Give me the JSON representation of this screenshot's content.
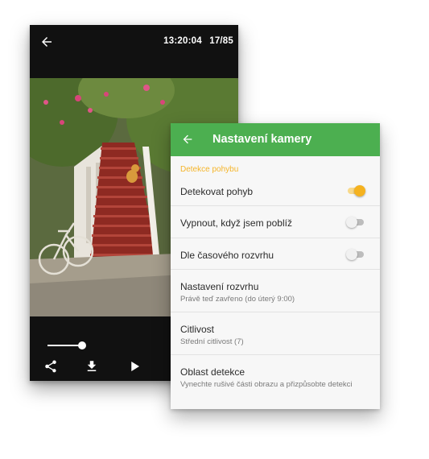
{
  "viewer": {
    "time": "13:20:04",
    "counter": "17/85",
    "playback_progress": 0.18
  },
  "icons": {
    "back": "arrow-left-icon",
    "share": "share-icon",
    "download": "download-icon",
    "play": "play-icon"
  },
  "settings": {
    "title": "Nastavení kamery",
    "section": "Detekce pohybu",
    "rows": [
      {
        "label": "Detekovat pohyb",
        "toggle": true
      },
      {
        "label": "Vypnout, když jsem poblíž",
        "toggle": false
      },
      {
        "label": "Dle časového rozvrhu",
        "toggle": false
      },
      {
        "label": "Nastavení rozvrhu",
        "sub": "Právě teď zavřeno (do úterý 9:00)"
      },
      {
        "label": "Citlivost",
        "sub": "Střední citlivost (7)"
      },
      {
        "label": "Oblast detekce",
        "sub": "Vynechte rušivé části obrazu a přizpůsobte detekci"
      }
    ]
  },
  "colors": {
    "appbar": "#4caf50",
    "accent": "#f5b21f",
    "section_header": "#f5b52a"
  }
}
